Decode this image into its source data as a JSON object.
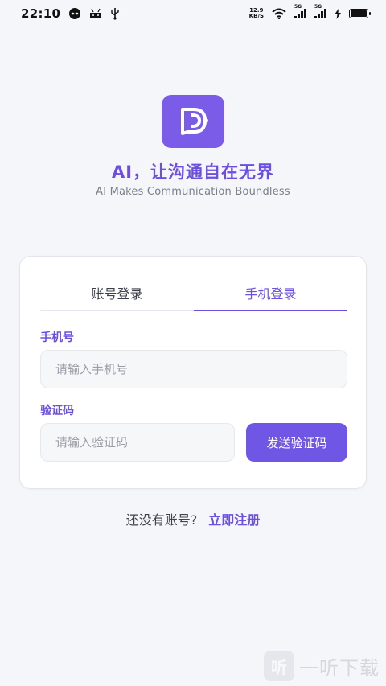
{
  "status_bar": {
    "time": "22:10",
    "net_speed_value": "12.9",
    "net_speed_unit": "KB/S",
    "signal1_tag": "5G",
    "signal2_tag": "5G",
    "icons": [
      "alien-icon",
      "android-icon",
      "usb-icon",
      "wifi-icon",
      "signal-icon",
      "signal-icon",
      "charging-icon",
      "battery-icon"
    ],
    "battery_level": 1.0
  },
  "brand": {
    "slogan": "AI，让沟通自在无界",
    "subslogan": "AI Makes Communication Boundless",
    "accent_color": "#6c4fe0",
    "logo_icon": "chat-d-logo-icon"
  },
  "login": {
    "tabs": [
      {
        "label": "账号登录",
        "active": false
      },
      {
        "label": "手机登录",
        "active": true
      }
    ],
    "phone_label": "手机号",
    "phone_placeholder": "请输入手机号",
    "phone_value": "",
    "code_label": "验证码",
    "code_placeholder": "请输入验证码",
    "code_value": "",
    "send_code_button": "发送验证码"
  },
  "footer": {
    "no_account_text": "还没有账号?",
    "register_link": "立即注册"
  },
  "watermark": {
    "badge": "听",
    "text": "一听下载"
  }
}
